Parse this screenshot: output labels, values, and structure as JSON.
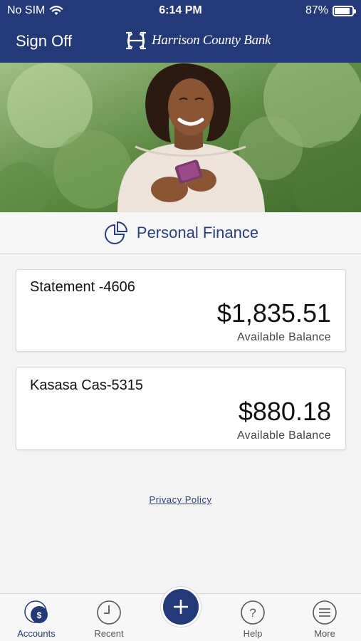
{
  "status_bar": {
    "carrier": "No SIM",
    "time": "6:14 PM",
    "battery": "87%",
    "battery_level": 0.87
  },
  "header": {
    "sign_off": "Sign Off",
    "brand_name": "Harrison County Bank"
  },
  "section": {
    "title": "Personal Finance"
  },
  "accounts": [
    {
      "name": "Statement -4606",
      "balance": "$1,835.51",
      "balance_label": "Available Balance"
    },
    {
      "name": "Kasasa Cas-5315",
      "balance": "$880.18",
      "balance_label": "Available Balance"
    }
  ],
  "footer": {
    "privacy_link": "Privacy Policy"
  },
  "tabbar": {
    "tabs": [
      {
        "label": "Accounts",
        "icon": "accounts-icon",
        "active": true
      },
      {
        "label": "Recent",
        "icon": "clock-icon"
      },
      {
        "label": "Help",
        "icon": "help-icon"
      },
      {
        "label": "More",
        "icon": "menu-icon"
      }
    ],
    "add_button_icon": "plus-icon"
  },
  "colors": {
    "brand": "#243a78",
    "background": "#f4f4f5"
  }
}
